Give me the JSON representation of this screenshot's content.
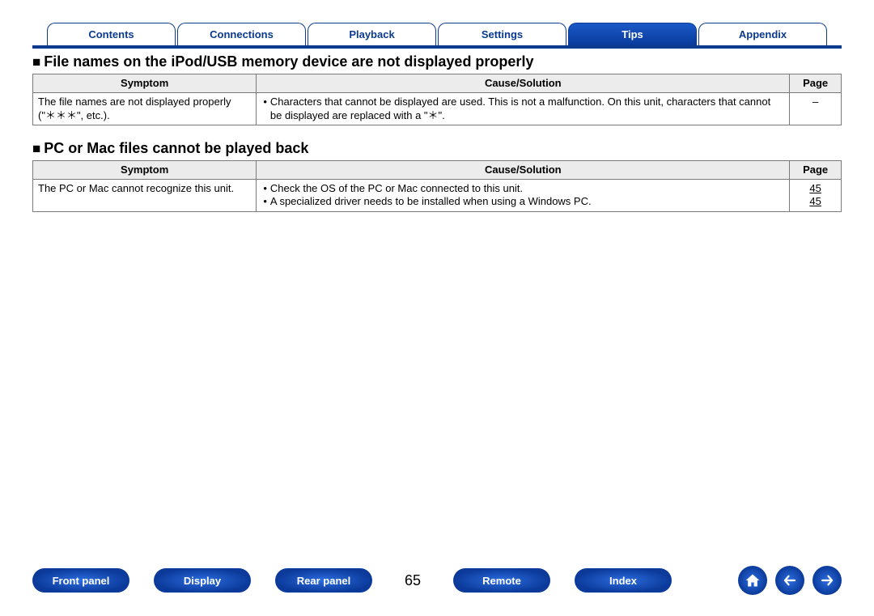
{
  "tabs": {
    "items": [
      {
        "label": "Contents",
        "active": false
      },
      {
        "label": "Connections",
        "active": false
      },
      {
        "label": "Playback",
        "active": false
      },
      {
        "label": "Settings",
        "active": false
      },
      {
        "label": "Tips",
        "active": true
      },
      {
        "label": "Appendix",
        "active": false
      }
    ]
  },
  "sections": [
    {
      "heading": "File names on the iPod/USB memory device are not displayed properly",
      "columns": [
        "Symptom",
        "Cause/Solution",
        "Page"
      ],
      "rows": [
        {
          "symptom": "The file names are not displayed properly (\"＊＊＊\", etc.).",
          "causes": [
            "Characters that cannot be displayed are used. This is not a malfunction. On this unit, characters that cannot be displayed are replaced with a \"＊\"."
          ],
          "pages": [
            "–"
          ]
        }
      ]
    },
    {
      "heading": "PC or Mac files cannot be played back",
      "columns": [
        "Symptom",
        "Cause/Solution",
        "Page"
      ],
      "rows": [
        {
          "symptom": "The PC or Mac cannot recognize this unit.",
          "causes": [
            "Check the OS of the PC or Mac connected to this unit.",
            "A specialized driver needs to be installed when using a Windows PC."
          ],
          "pages": [
            "45",
            "45"
          ]
        }
      ]
    }
  ],
  "bottom": {
    "pills": [
      "Front panel",
      "Display",
      "Rear panel",
      "Remote",
      "Index"
    ],
    "page": "65"
  }
}
